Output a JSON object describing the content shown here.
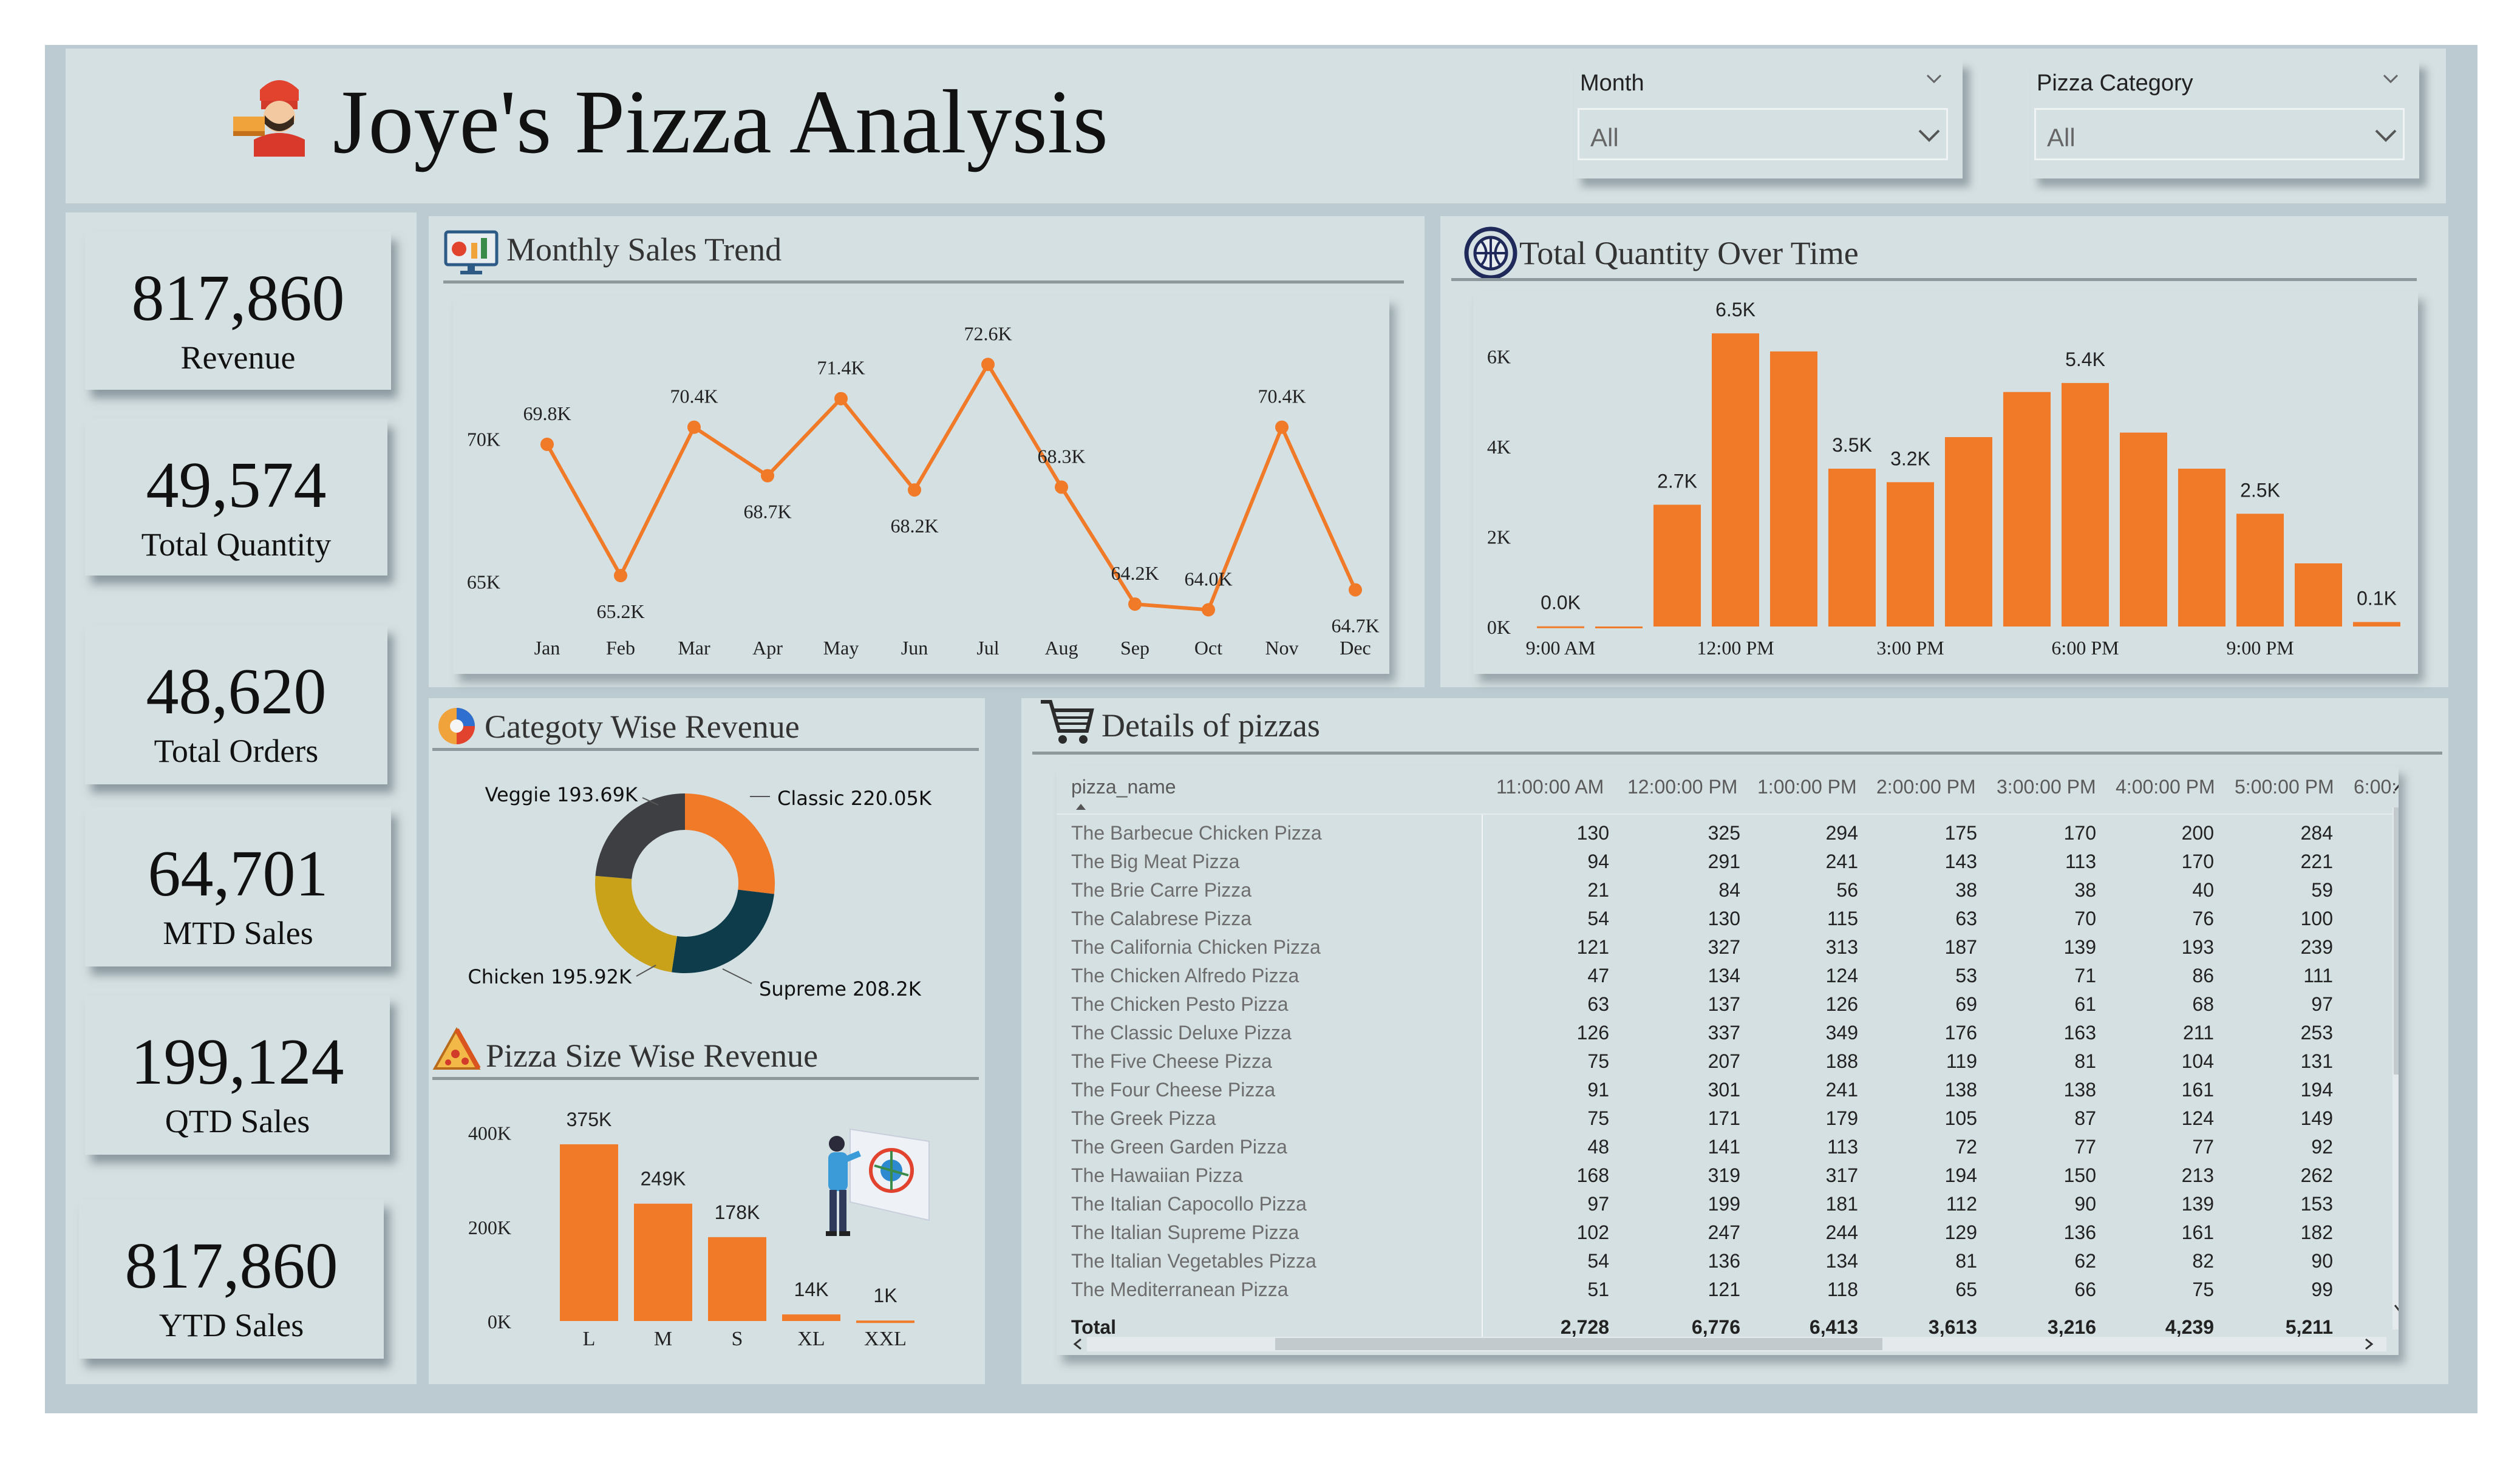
{
  "header": {
    "title": "Joye's Pizza Analysis"
  },
  "filters": [
    {
      "label": "Month",
      "value": "All"
    },
    {
      "label": "Pizza Category",
      "value": "All"
    }
  ],
  "kpis": [
    {
      "value": "817,860",
      "label": "Revenue"
    },
    {
      "value": "49,574",
      "label": "Total Quantity"
    },
    {
      "value": "48,620",
      "label": "Total Orders"
    },
    {
      "value": "64,701",
      "label": "MTD Sales"
    },
    {
      "value": "199,124",
      "label": "QTD Sales"
    },
    {
      "value": "817,860",
      "label": "YTD Sales"
    }
  ],
  "monthly": {
    "title": "Monthly Sales Trend"
  },
  "quantity": {
    "title": "Total Quantity Over Time"
  },
  "category": {
    "title": "Categoty Wise Revenue"
  },
  "size": {
    "title": "Pizza Size Wise Revenue"
  },
  "details": {
    "title": "Details of pizzas",
    "columns": [
      "pizza_name",
      "11:00:00 AM",
      "12:00:00 PM",
      "1:00:00 PM",
      "2:00:00 PM",
      "3:00:00 PM",
      "4:00:00 PM",
      "5:00:00 PM",
      "6:00:"
    ],
    "rows": [
      [
        "The Barbecue Chicken Pizza",
        "130",
        "325",
        "294",
        "175",
        "170",
        "200",
        "284"
      ],
      [
        "The Big Meat Pizza",
        "94",
        "291",
        "241",
        "143",
        "113",
        "170",
        "221"
      ],
      [
        "The Brie Carre Pizza",
        "21",
        "84",
        "56",
        "38",
        "38",
        "40",
        "59"
      ],
      [
        "The Calabrese Pizza",
        "54",
        "130",
        "115",
        "63",
        "70",
        "76",
        "100"
      ],
      [
        "The California Chicken Pizza",
        "121",
        "327",
        "313",
        "187",
        "139",
        "193",
        "239"
      ],
      [
        "The Chicken Alfredo Pizza",
        "47",
        "134",
        "124",
        "53",
        "71",
        "86",
        "111"
      ],
      [
        "The Chicken Pesto Pizza",
        "63",
        "137",
        "126",
        "69",
        "61",
        "68",
        "97"
      ],
      [
        "The Classic Deluxe Pizza",
        "126",
        "337",
        "349",
        "176",
        "163",
        "211",
        "253"
      ],
      [
        "The Five Cheese Pizza",
        "75",
        "207",
        "188",
        "119",
        "81",
        "104",
        "131"
      ],
      [
        "The Four Cheese Pizza",
        "91",
        "301",
        "241",
        "138",
        "138",
        "161",
        "194"
      ],
      [
        "The Greek Pizza",
        "75",
        "171",
        "179",
        "105",
        "87",
        "124",
        "149"
      ],
      [
        "The Green Garden Pizza",
        "48",
        "141",
        "113",
        "72",
        "77",
        "77",
        "92"
      ],
      [
        "The Hawaiian Pizza",
        "168",
        "319",
        "317",
        "194",
        "150",
        "213",
        "262"
      ],
      [
        "The Italian Capocollo Pizza",
        "97",
        "199",
        "181",
        "112",
        "90",
        "139",
        "153"
      ],
      [
        "The Italian Supreme Pizza",
        "102",
        "247",
        "244",
        "129",
        "136",
        "161",
        "182"
      ],
      [
        "The Italian Vegetables Pizza",
        "54",
        "136",
        "134",
        "81",
        "62",
        "82",
        "90"
      ],
      [
        "The Mediterranean Pizza",
        "51",
        "121",
        "118",
        "65",
        "66",
        "75",
        "99"
      ]
    ],
    "total": [
      "Total",
      "2,728",
      "6,776",
      "6,413",
      "3,613",
      "3,216",
      "4,239",
      "5,211"
    ]
  },
  "colors": {
    "accent": "#f07a28",
    "panel": "#d5e0e2",
    "frame": "#bccbd1",
    "navy": "#0e3c4a",
    "gray": "#3e3f42",
    "gold": "#c9a21a"
  },
  "chart_data": [
    {
      "type": "line",
      "title": "Monthly Sales Trend",
      "categories": [
        "Jan",
        "Feb",
        "Mar",
        "Apr",
        "May",
        "Jun",
        "Jul",
        "Aug",
        "Sep",
        "Oct",
        "Nov",
        "Dec"
      ],
      "values": [
        69800,
        65200,
        70400,
        68700,
        71400,
        68200,
        72600,
        68300,
        64200,
        64000,
        70400,
        64700
      ],
      "data_labels": [
        "69.8K",
        "65.2K",
        "70.4K",
        "68.7K",
        "71.4K",
        "68.2K",
        "72.6K",
        "68.3K",
        "64.2K",
        "64.0K",
        "70.4K",
        "64.7K"
      ],
      "yticks": [
        "65K",
        "70K"
      ],
      "ylim": [
        63500,
        73500
      ]
    },
    {
      "type": "bar",
      "title": "Total Quantity Over Time",
      "categories": [
        "9:00 AM",
        "10:00 AM",
        "11:00 AM",
        "12:00 PM",
        "1:00 PM",
        "2:00 PM",
        "3:00 PM",
        "4:00 PM",
        "5:00 PM",
        "6:00 PM",
        "7:00 PM",
        "8:00 PM",
        "9:00 PM",
        "10:00 PM",
        "11:00 PM"
      ],
      "xtick_labels": [
        "9:00 AM",
        "12:00 PM",
        "3:00 PM",
        "6:00 PM",
        "9:00 PM"
      ],
      "values": [
        4,
        0,
        2700,
        6500,
        6100,
        3500,
        3200,
        4200,
        5200,
        5400,
        4300,
        3500,
        2500,
        1400,
        100
      ],
      "data_labels": [
        "0.0K",
        "",
        "2.7K",
        "6.5K",
        "",
        "3.5K",
        "3.2K",
        "",
        "",
        "5.4K",
        "",
        "",
        "2.5K",
        "",
        "0.1K"
      ],
      "yticks": [
        "0K",
        "2K",
        "4K",
        "6K"
      ],
      "ylim": [
        0,
        7000
      ]
    },
    {
      "type": "pie",
      "title": "Categoty Wise Revenue",
      "labels": [
        "Classic",
        "Supreme",
        "Chicken",
        "Veggie"
      ],
      "values": [
        220050,
        208200,
        195920,
        193690
      ],
      "data_labels": [
        "Classic 220.05K",
        "Supreme 208.2K",
        "Chicken 195.92K",
        "Veggie 193.69K"
      ]
    },
    {
      "type": "bar",
      "title": "Pizza Size Wise Revenue",
      "categories": [
        "L",
        "M",
        "S",
        "XL",
        "XXL"
      ],
      "values": [
        375000,
        249000,
        178000,
        14000,
        1000
      ],
      "data_labels": [
        "375K",
        "249K",
        "178K",
        "14K",
        "1K"
      ],
      "yticks": [
        "0K",
        "200K",
        "400K"
      ],
      "ylim": [
        0,
        420000
      ]
    }
  ]
}
